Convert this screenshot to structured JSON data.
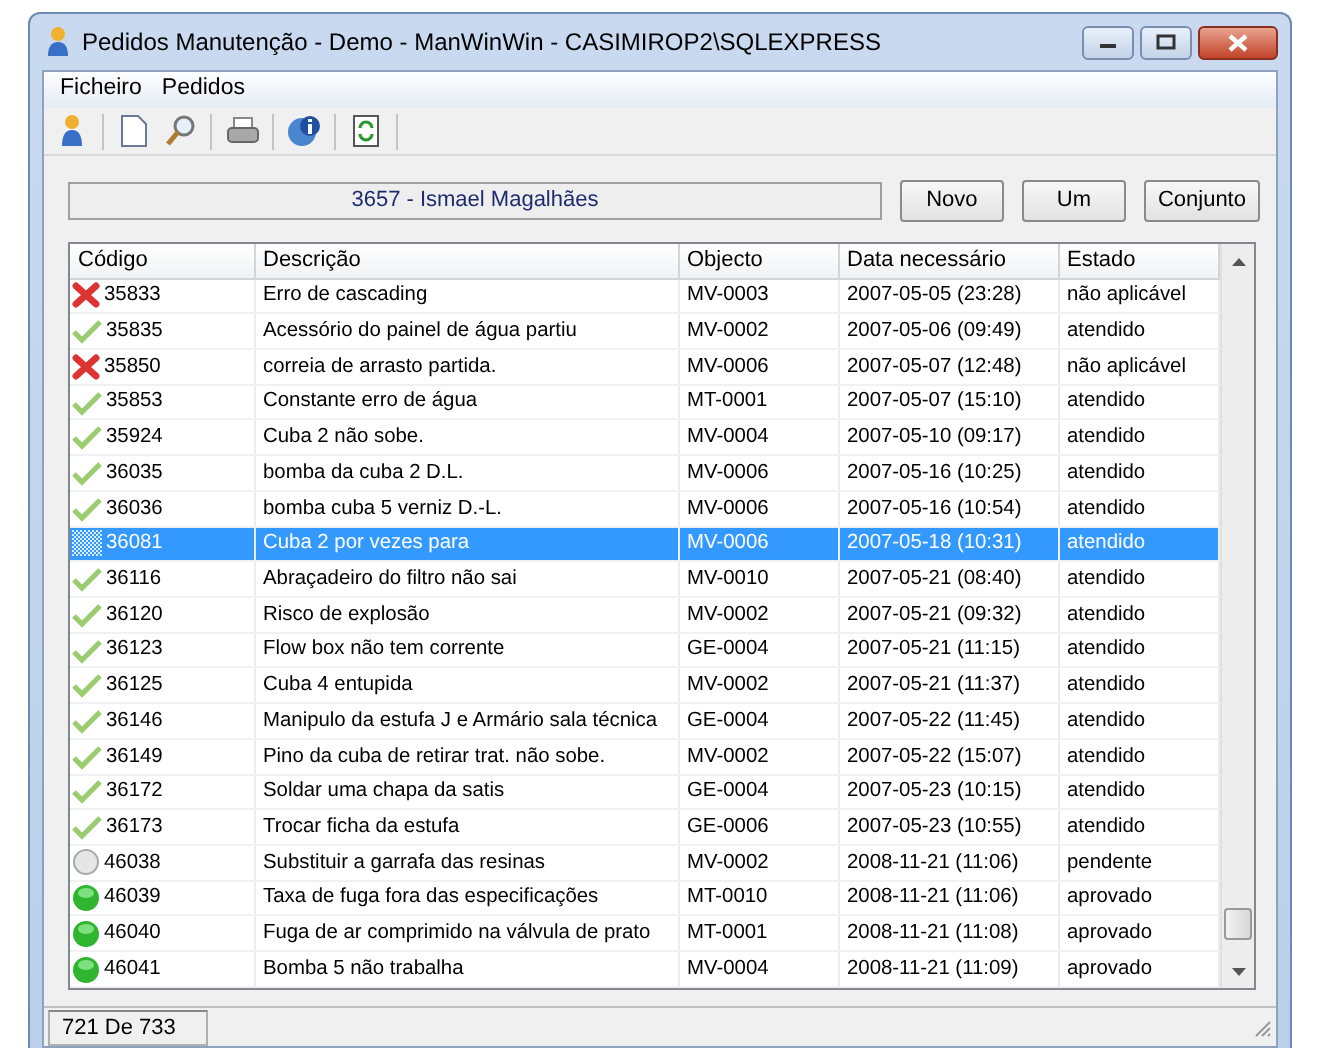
{
  "window": {
    "title": "Pedidos Manutenção - Demo - ManWinWin  - CASIMIROP2\\SQLEXPRESS"
  },
  "menu": [
    "Ficheiro",
    "Pedidos"
  ],
  "customer": "3657 - Ismael Magalhães",
  "buttons": [
    "Novo",
    "Um",
    "Conjunto"
  ],
  "table": {
    "columns": [
      "Código",
      "Descrição",
      "Objecto",
      "Data necessário",
      "Estado"
    ],
    "rows": [
      {
        "kind": "rejected",
        "selected": false,
        "cells": [
          "35833",
          "Erro de cascading",
          "MV-0003",
          "2007-05-05 (23:28)",
          "não aplicável"
        ]
      },
      {
        "kind": "done",
        "selected": false,
        "cells": [
          "35835",
          "Acessório do painel de água partiu",
          "MV-0002",
          "2007-05-06 (09:49)",
          "atendido"
        ]
      },
      {
        "kind": "rejected",
        "selected": false,
        "cells": [
          "35850",
          "correia de arrasto partida.",
          "MV-0006",
          "2007-05-07 (12:48)",
          "não aplicável"
        ]
      },
      {
        "kind": "done",
        "selected": false,
        "cells": [
          "35853",
          "Constante erro de água",
          "MT-0001",
          "2007-05-07 (15:10)",
          "atendido"
        ]
      },
      {
        "kind": "done",
        "selected": false,
        "cells": [
          "35924",
          "Cuba 2 não sobe.",
          "MV-0004",
          "2007-05-10 (09:17)",
          "atendido"
        ]
      },
      {
        "kind": "done",
        "selected": false,
        "cells": [
          "36035",
          "bomba da cuba 2 D.L.",
          "MV-0006",
          "2007-05-16 (10:25)",
          "atendido"
        ]
      },
      {
        "kind": "done",
        "selected": false,
        "cells": [
          "36036",
          "bomba cuba 5 verniz D.-L.",
          "MV-0006",
          "2007-05-16 (10:54)",
          "atendido"
        ]
      },
      {
        "kind": "done",
        "selected": true,
        "cells": [
          "36081",
          "Cuba 2 por vezes para",
          "MV-0006",
          "2007-05-18 (10:31)",
          "atendido"
        ]
      },
      {
        "kind": "done",
        "selected": false,
        "cells": [
          "36116",
          "Abraçadeiro do filtro não sai",
          "MV-0010",
          "2007-05-21 (08:40)",
          "atendido"
        ]
      },
      {
        "kind": "done",
        "selected": false,
        "cells": [
          "36120",
          "Risco de explosão",
          "MV-0002",
          "2007-05-21 (09:32)",
          "atendido"
        ]
      },
      {
        "kind": "done",
        "selected": false,
        "cells": [
          "36123",
          "Flow box não tem corrente",
          "GE-0004",
          "2007-05-21 (11:15)",
          "atendido"
        ]
      },
      {
        "kind": "done",
        "selected": false,
        "cells": [
          "36125",
          "Cuba 4 entupida",
          "MV-0002",
          "2007-05-21 (11:37)",
          "atendido"
        ]
      },
      {
        "kind": "done",
        "selected": false,
        "cells": [
          "36146",
          "Manipulo da estufa J e Armário sala técnica",
          "GE-0004",
          "2007-05-22 (11:45)",
          "atendido"
        ]
      },
      {
        "kind": "done",
        "selected": false,
        "cells": [
          "36149",
          "Pino da cuba de retirar trat. não sobe.",
          "MV-0002",
          "2007-05-22 (15:07)",
          "atendido"
        ]
      },
      {
        "kind": "done",
        "selected": false,
        "cells": [
          "36172",
          "Soldar uma chapa da satis",
          "GE-0004",
          "2007-05-23 (10:15)",
          "atendido"
        ]
      },
      {
        "kind": "done",
        "selected": false,
        "cells": [
          "36173",
          "Trocar ficha da estufa",
          "GE-0006",
          "2007-05-23 (10:55)",
          "atendido"
        ]
      },
      {
        "kind": "pending",
        "selected": false,
        "cells": [
          "46038",
          "Substituir a garrafa das resinas",
          "MV-0002",
          "2008-11-21 (11:06)",
          "pendente"
        ]
      },
      {
        "kind": "approved",
        "selected": false,
        "cells": [
          "46039",
          "Taxa de fuga fora das especificações",
          "MT-0010",
          "2008-11-21 (11:06)",
          "aprovado"
        ]
      },
      {
        "kind": "approved",
        "selected": false,
        "cells": [
          "46040",
          "Fuga de ar comprimido na válvula de prato",
          "MT-0001",
          "2008-11-21 (11:08)",
          "aprovado"
        ]
      },
      {
        "kind": "approved",
        "selected": false,
        "cells": [
          "46041",
          "Bomba 5 não trabalha",
          "MV-0004",
          "2008-11-21 (11:09)",
          "aprovado"
        ]
      }
    ]
  },
  "status_bar": "721 De 733"
}
